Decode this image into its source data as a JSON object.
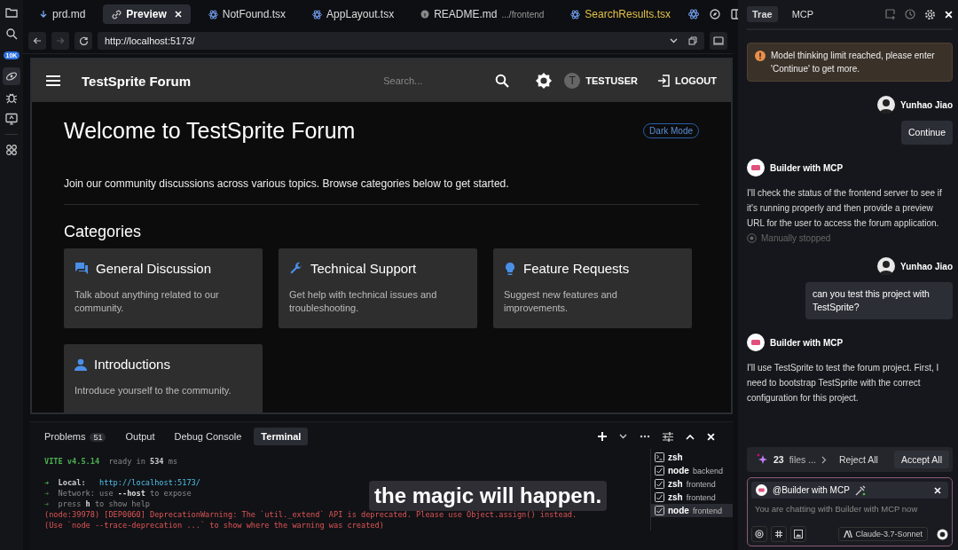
{
  "activity_bar": {
    "items": [
      {
        "kind": "files",
        "selected": false
      },
      {
        "kind": "search",
        "selected": false
      },
      {
        "kind": "badge",
        "badge": "10K",
        "selected": false
      },
      {
        "kind": "link",
        "selected": true
      },
      {
        "kind": "bug",
        "selected": false
      },
      {
        "kind": "monitor",
        "selected": false
      },
      {
        "kind": "grid",
        "selected": false
      }
    ]
  },
  "editor_tabs": [
    {
      "label": "prd.md",
      "kind": "download",
      "selected": false,
      "modified": false
    },
    {
      "label": "Preview",
      "kind": "link",
      "selected": true,
      "modified": false
    },
    {
      "label": "NotFound.tsx",
      "kind": "react",
      "selected": false,
      "modified": false
    },
    {
      "label": "AppLayout.tsx",
      "kind": "react",
      "selected": false,
      "modified": false
    },
    {
      "label": "README.md",
      "path": ".../frontend",
      "kind": "info",
      "selected": false,
      "modified": false
    },
    {
      "label": "SearchResults.tsx",
      "kind": "react",
      "selected": false,
      "modified": true
    }
  ],
  "address_bar": {
    "url": "http://localhost:5173/"
  },
  "preview": {
    "app_bar": {
      "title": "TestSprite Forum",
      "search_placeholder": "Search...",
      "avatar_letter": "T",
      "user": "TESTUSER",
      "logout": "LOGOUT"
    },
    "heading": "Welcome to TestSprite Forum",
    "theme_chip": "Dark Mode",
    "intro": "Join our community discussions across various topics. Browse categories below to get started.",
    "categories_title": "Categories",
    "categories": [
      {
        "kind": "chat",
        "title": "General Discussion",
        "description": "Talk about anything related to our community."
      },
      {
        "kind": "wrench",
        "title": "Technical Support",
        "description": "Get help with technical issues and troubleshooting."
      },
      {
        "kind": "bulb",
        "title": "Feature Requests",
        "description": "Suggest new features and improvements."
      },
      {
        "kind": "person",
        "title": "Introductions",
        "description": "Introduce yourself to the community."
      }
    ]
  },
  "panel": {
    "tabs": [
      {
        "label": "Problems",
        "count": "51",
        "selected": false
      },
      {
        "label": "Output",
        "selected": false
      },
      {
        "label": "Debug Console",
        "selected": false
      },
      {
        "label": "Terminal",
        "selected": true
      }
    ],
    "terminal_lines": [
      {
        "kind": "vite",
        "parts": [
          "VITE v4.5.14",
          "  ready in ",
          "534",
          " ms"
        ]
      },
      {
        "kind": "blank"
      },
      {
        "kind": "local",
        "parts": [
          "➜  ",
          "Local:",
          "   http://localhost:5173/"
        ]
      },
      {
        "kind": "dim",
        "parts": [
          "➜  ",
          "Network: use ",
          "--host",
          " to expose"
        ]
      },
      {
        "kind": "dim",
        "parts": [
          "➜  ",
          "press ",
          "h",
          " to show help"
        ]
      },
      {
        "kind": "error",
        "text": "(node:39978) [DEP0060] DeprecationWarning: The `util._extend` API is deprecated. Please use Object.assign() instead."
      },
      {
        "kind": "error",
        "text": "(Use `node --trace-deprecation ...` to show where the warning was created)"
      }
    ],
    "terminals": [
      {
        "name": "zsh",
        "kind": "shell",
        "selected": false
      },
      {
        "name": "node",
        "detail": "backend",
        "kind": "task",
        "selected": false
      },
      {
        "name": "zsh",
        "detail": "frontend",
        "kind": "task",
        "selected": false
      },
      {
        "name": "zsh",
        "detail": "frontend",
        "kind": "task",
        "selected": false
      },
      {
        "name": "node",
        "detail": "frontend",
        "kind": "task",
        "selected": true
      }
    ]
  },
  "caption": "the magic will happen.",
  "chat": {
    "tabs": [
      {
        "label": "Trae",
        "selected": true
      },
      {
        "label": "MCP",
        "selected": false
      }
    ],
    "messages": [
      {
        "kind": "notice",
        "text": "Model thinking limit reached, please enter 'Continue' to get more."
      },
      {
        "kind": "user",
        "author": "Yunhao Jiao",
        "text": "Continue"
      },
      {
        "kind": "agent",
        "author": "Builder with MCP",
        "text": "I'll check the status of the frontend server to see if it's running properly and then provide a preview URL for the user to access the forum application.",
        "status": "Manually stopped"
      },
      {
        "kind": "user",
        "author": "Yunhao Jiao",
        "text": "can you test this project with TestSprite?"
      },
      {
        "kind": "agent",
        "author": "Builder with MCP",
        "text": "I'll use TestSprite to test the forum project. First, I need to bootstrap TestSprite with the correct configuration for this project."
      }
    ],
    "changes": {
      "count": "23",
      "label": "files ...",
      "reject": "Reject All",
      "accept": "Accept All"
    },
    "composer": {
      "agent": "@Builder with MCP",
      "placeholder": "You are chatting with Builder with MCP now",
      "model": "Claude-3.7-Sonnet"
    }
  }
}
